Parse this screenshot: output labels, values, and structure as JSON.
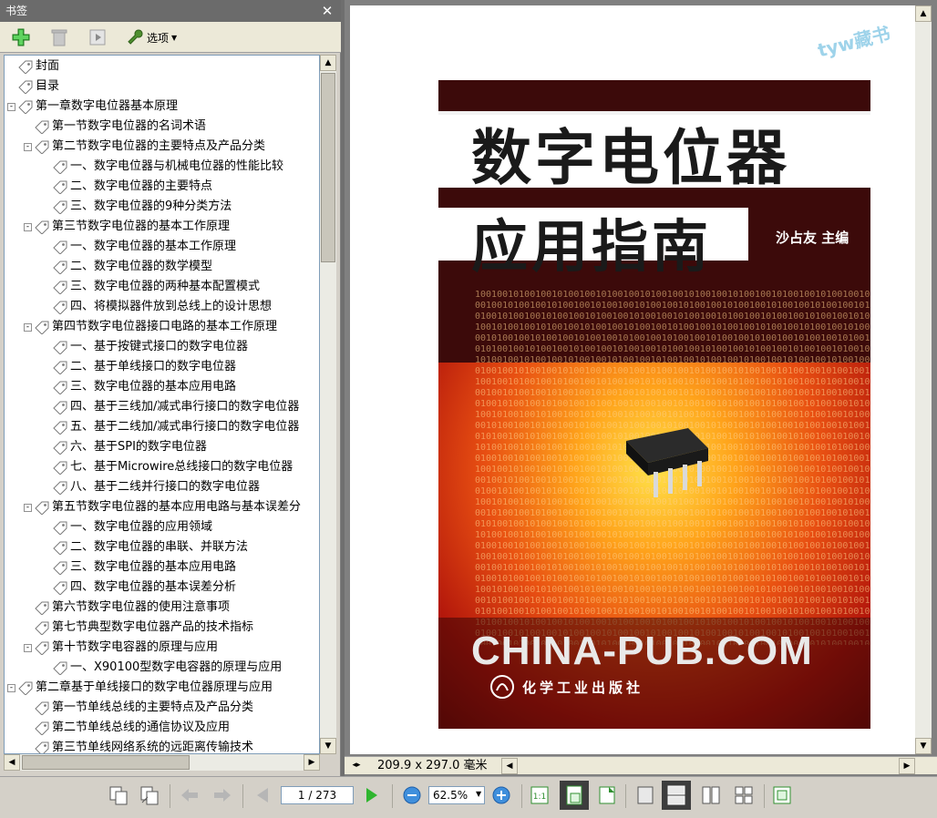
{
  "bookmarks_panel": {
    "title": "书签",
    "options_label": "选项",
    "icons": {
      "add": "add-bookmark-icon",
      "delete": "delete-bookmark-icon",
      "expand": "expand-icon",
      "options": "wrench-icon",
      "close": "close-icon"
    }
  },
  "bookmarks": [
    {
      "label": "封面",
      "level": 0,
      "toggle": ""
    },
    {
      "label": "目录",
      "level": 0,
      "toggle": ""
    },
    {
      "label": "第一章数字电位器基本原理",
      "level": 0,
      "toggle": "-"
    },
    {
      "label": "第一节数字电位器的名词术语",
      "level": 1,
      "toggle": ""
    },
    {
      "label": "第二节数字电位器的主要特点及产品分类",
      "level": 1,
      "toggle": "-"
    },
    {
      "label": "一、数字电位器与机械电位器的性能比较",
      "level": 2,
      "toggle": ""
    },
    {
      "label": "二、数字电位器的主要特点",
      "level": 2,
      "toggle": ""
    },
    {
      "label": "三、数字电位器的9种分类方法",
      "level": 2,
      "toggle": ""
    },
    {
      "label": "第三节数字电位器的基本工作原理",
      "level": 1,
      "toggle": "-"
    },
    {
      "label": "一、数字电位器的基本工作原理",
      "level": 2,
      "toggle": ""
    },
    {
      "label": "二、数字电位器的数学模型",
      "level": 2,
      "toggle": ""
    },
    {
      "label": "三、数字电位器的两种基本配置模式",
      "level": 2,
      "toggle": ""
    },
    {
      "label": "四、将模拟器件放到总线上的设计思想",
      "level": 2,
      "toggle": ""
    },
    {
      "label": "第四节数字电位器接口电路的基本工作原理",
      "level": 1,
      "toggle": "-"
    },
    {
      "label": "一、基于按键式接口的数字电位器",
      "level": 2,
      "toggle": ""
    },
    {
      "label": "二、基于单线接口的数字电位器",
      "level": 2,
      "toggle": ""
    },
    {
      "label": "三、数字电位器的基本应用电路",
      "level": 2,
      "toggle": ""
    },
    {
      "label": "四、基于三线加/减式串行接口的数字电位器",
      "level": 2,
      "toggle": ""
    },
    {
      "label": "五、基于二线加/减式串行接口的数字电位器",
      "level": 2,
      "toggle": ""
    },
    {
      "label": "六、基于SPI的数字电位器",
      "level": 2,
      "toggle": ""
    },
    {
      "label": "七、基于Microwire总线接口的数字电位器",
      "level": 2,
      "toggle": ""
    },
    {
      "label": "八、基于二线并行接口的数字电位器",
      "level": 2,
      "toggle": ""
    },
    {
      "label": "第五节数字电位器的基本应用电路与基本误差分",
      "level": 1,
      "toggle": "-"
    },
    {
      "label": "一、数字电位器的应用领域",
      "level": 2,
      "toggle": ""
    },
    {
      "label": "二、数字电位器的串联、并联方法",
      "level": 2,
      "toggle": ""
    },
    {
      "label": "三、数字电位器的基本应用电路",
      "level": 2,
      "toggle": ""
    },
    {
      "label": "四、数字电位器的基本误差分析",
      "level": 2,
      "toggle": ""
    },
    {
      "label": "第六节数字电位器的使用注意事项",
      "level": 1,
      "toggle": ""
    },
    {
      "label": "第七节典型数字电位器产品的技术指标",
      "level": 1,
      "toggle": ""
    },
    {
      "label": "第十节数字电容器的原理与应用",
      "level": 1,
      "toggle": "-"
    },
    {
      "label": "一、X90100型数字电容器的原理与应用",
      "level": 2,
      "toggle": ""
    },
    {
      "label": "第二章基于单线接口的数字电位器原理与应用",
      "level": 0,
      "toggle": "-"
    },
    {
      "label": "第一节单线总线的主要特点及产品分类",
      "level": 1,
      "toggle": ""
    },
    {
      "label": "第二节单线总线的通信协议及应用",
      "level": 1,
      "toggle": ""
    },
    {
      "label": "第三节单线网络系统的远距离传输技术",
      "level": 1,
      "toggle": ""
    }
  ],
  "document": {
    "watermark": "tyw藏书",
    "cover": {
      "title_line1": "数字电位器",
      "title_line2": "应用指南",
      "author": "沙占友  主编",
      "publisher_url": "CHINA-PUB.COM",
      "publisher_name": "化学工业出版社"
    },
    "page_size": "209.9 x 297.0 毫米"
  },
  "navigation": {
    "page_display": "1 / 273",
    "zoom": "62.5%"
  },
  "colors": {
    "panel_bg": "#d4d0c8",
    "titlebar": "#6b6b6b",
    "cover_dark": "#3c0a0a",
    "cover_glow": "#ffa41b"
  }
}
